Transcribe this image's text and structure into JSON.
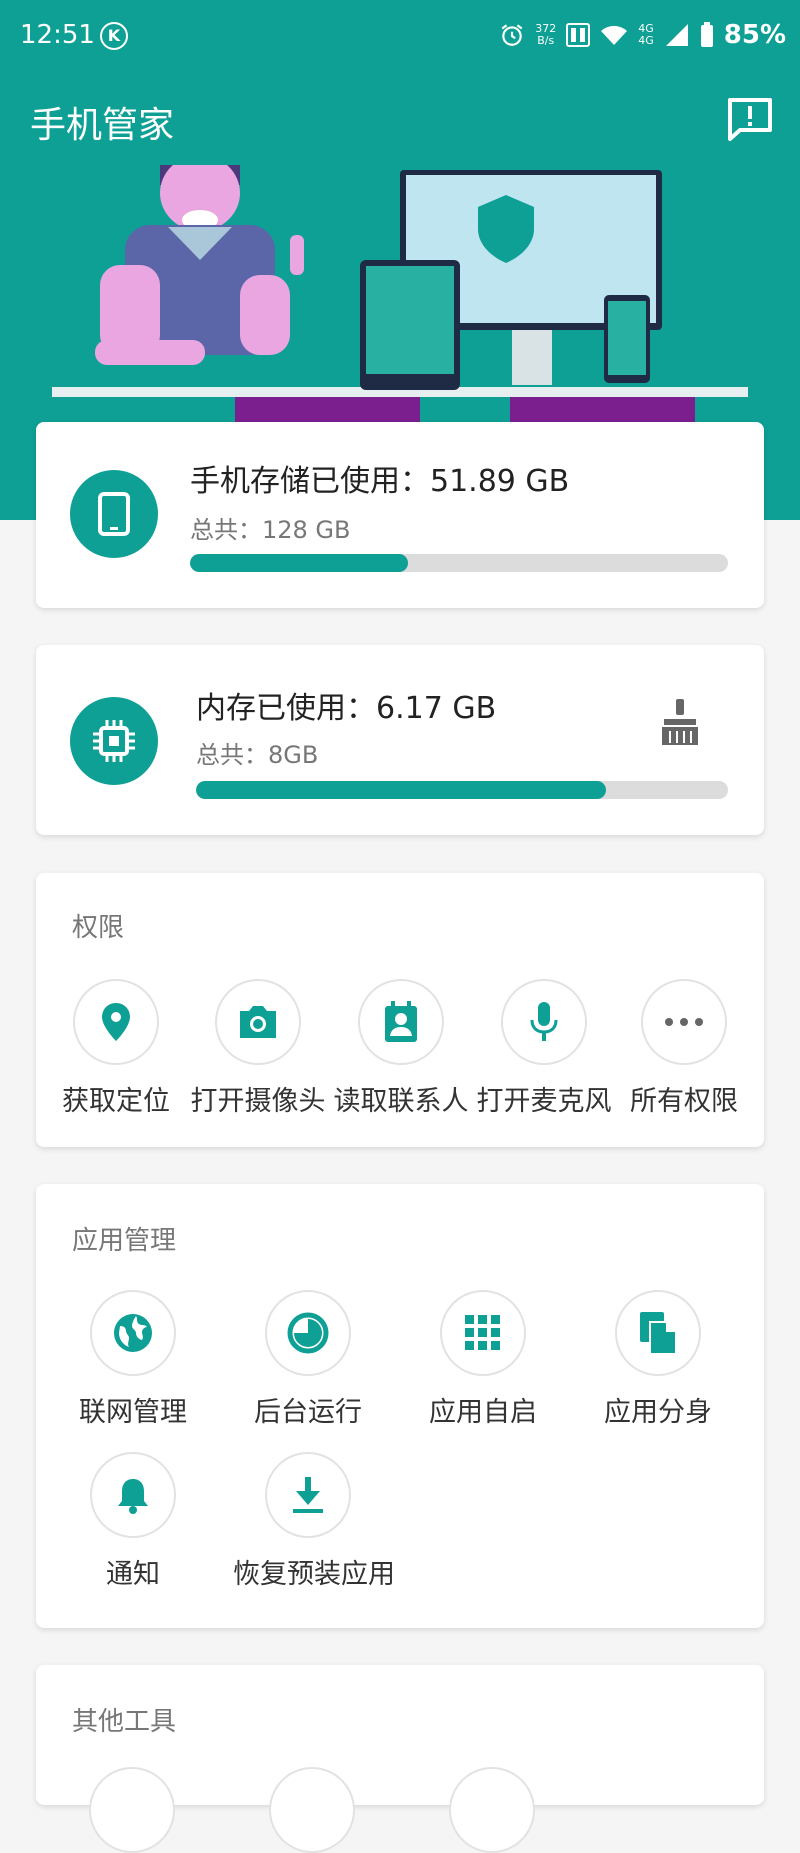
{
  "status_bar": {
    "time": "12:51",
    "k_badge": "K",
    "net_speed_value": "372",
    "net_speed_unit": "B/s",
    "network_1": "4G",
    "network_2": "4G",
    "battery": "85%"
  },
  "app_bar": {
    "title": "手机管家",
    "feedback_icon": "feedback-icon"
  },
  "storage_card": {
    "title": "手机存储已使用：51.89 GB",
    "total": "总共：128 GB",
    "used_fraction": 0.405,
    "icon": "phone-icon"
  },
  "memory_card": {
    "title": "内存已使用：6.17 GB",
    "total": "总共：8GB",
    "used_fraction": 0.771,
    "icon": "chip-icon",
    "clean_icon": "broom-icon"
  },
  "permissions": {
    "title": "权限",
    "items": [
      {
        "label": "获取定位",
        "icon": "location-icon"
      },
      {
        "label": "打开摄像头",
        "icon": "camera-icon"
      },
      {
        "label": "读取联系人",
        "icon": "contact-icon"
      },
      {
        "label": "打开麦克风",
        "icon": "mic-icon"
      },
      {
        "label": "所有权限",
        "icon": "more-icon"
      }
    ]
  },
  "app_management": {
    "title": "应用管理",
    "items": [
      {
        "label": "联网管理",
        "icon": "globe-icon"
      },
      {
        "label": "后台运行",
        "icon": "pie-icon"
      },
      {
        "label": "应用自启",
        "icon": "apps-grid-icon"
      },
      {
        "label": "应用分身",
        "icon": "copy-icon"
      },
      {
        "label": "通知",
        "icon": "bell-icon"
      },
      {
        "label": "恢复预装应用",
        "icon": "download-icon"
      }
    ]
  },
  "other_tools": {
    "title": "其他工具"
  },
  "colors": {
    "accent": "#0e9f95",
    "purple": "#7b1f8f",
    "progress_track": "#dcdcdc"
  }
}
